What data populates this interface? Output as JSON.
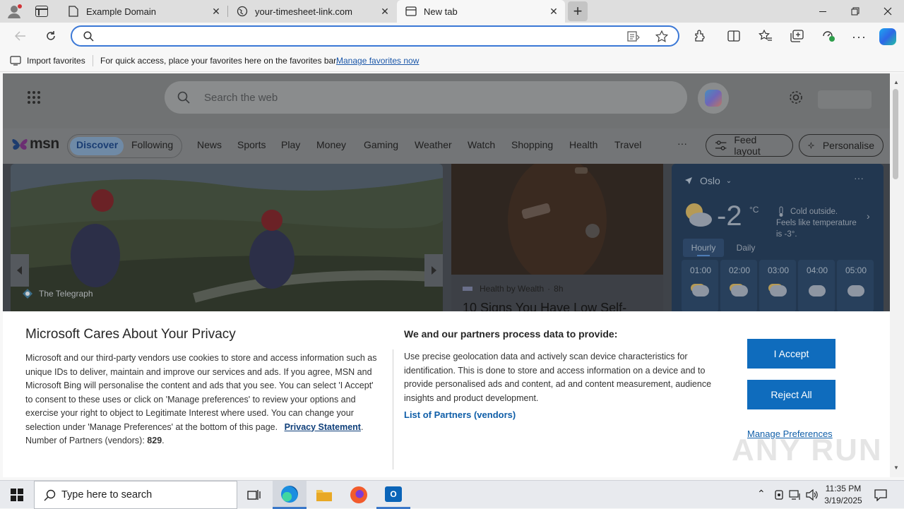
{
  "browser": {
    "tabs": [
      {
        "title": "Example Domain",
        "active": false
      },
      {
        "title": "your-timesheet-link.com",
        "active": false
      },
      {
        "title": "New tab",
        "active": true
      }
    ],
    "address_value": "",
    "favorites_bar": {
      "import_label": "Import favorites",
      "message": "For quick access, place your favorites here on the favorites bar.",
      "manage_link": "Manage favorites now"
    }
  },
  "msn": {
    "search_placeholder": "Search the web",
    "logo": "msn",
    "nav": [
      "Discover",
      "Following",
      "News",
      "Sports",
      "Play",
      "Money",
      "Gaming",
      "Weather",
      "Watch",
      "Shopping",
      "Health",
      "Travel"
    ],
    "more": "···",
    "feed_layout": "Feed layout",
    "personalise": "Personalise",
    "hero_card": {
      "source": "The Telegraph"
    },
    "health_card": {
      "source": "Health by Wealth",
      "age": "8h",
      "headline": "10 Signs You Have Low Self-"
    },
    "weather": {
      "location": "Oslo",
      "temp": "-2",
      "unit": "°C",
      "desc": "Cold outside. Feels like temperature is -3°.",
      "tabs": [
        "Hourly",
        "Daily"
      ],
      "hours": [
        "01:00",
        "02:00",
        "03:00",
        "04:00",
        "05:00"
      ]
    }
  },
  "privacy": {
    "title": "Microsoft Cares About Your Privacy",
    "body": "Microsoft and our third-party vendors use cookies to store and access information such as unique IDs to deliver, maintain and improve our services and ads. If you agree, MSN and Microsoft Bing will personalise the content and ads that you see. You can select 'I Accept' to consent to these uses or click on 'Manage preferences' to review your options and exercise your right to object to Legitimate Interest where used.  You can change your selection under 'Manage Preferences' at the bottom of this page.",
    "privacy_link": "Privacy Statement",
    "partners_label": "Number of Partners (vendors):",
    "partners_count": "829",
    "right_title": "We and our partners process data to provide:",
    "right_body": "Use precise geolocation data and actively scan device characteristics for identification. This is done to store and access information on a device and to provide personalised ads and content, ad and content measurement, audience insights and product development.",
    "partners_link": "List of Partners (vendors)",
    "accept": "I Accept",
    "reject": "Reject All",
    "manage": "Manage Preferences"
  },
  "taskbar": {
    "search_placeholder": "Type here to search",
    "time": "11:35 PM",
    "date": "3/19/2025"
  },
  "watermark": "ANY RUN"
}
